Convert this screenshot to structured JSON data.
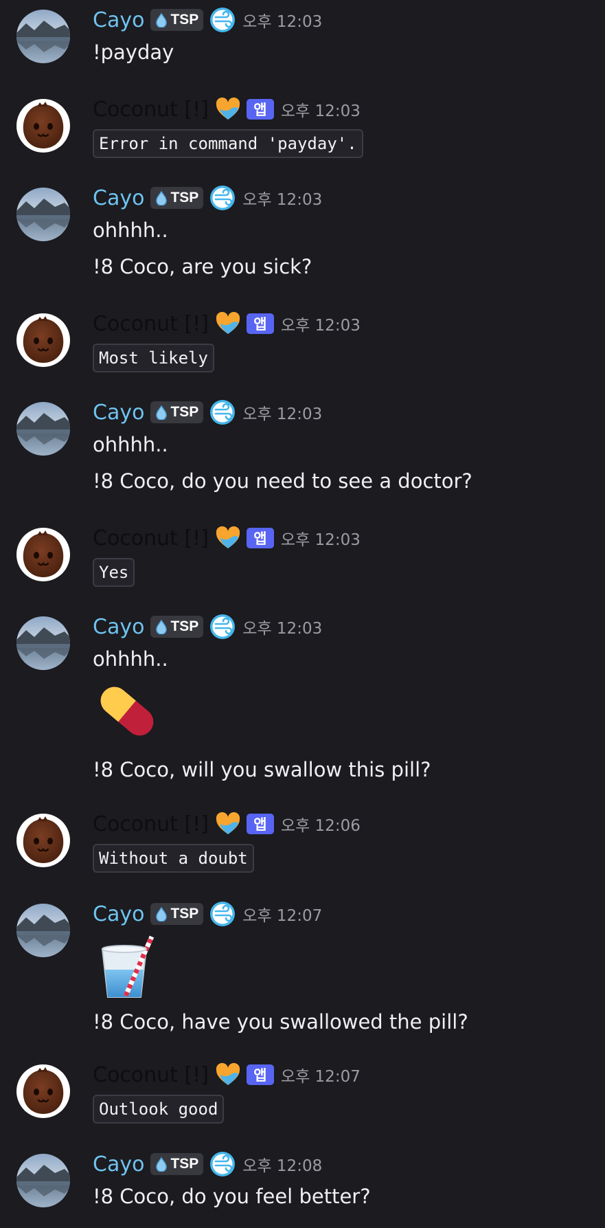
{
  "users": {
    "cayo": {
      "name": "Cayo",
      "tag": "TSP"
    },
    "coco": {
      "name": "Coconut [!]",
      "app_badge": "앱"
    }
  },
  "colors": {
    "background": "#1b1b20",
    "cayo_name": "#6fc3ef",
    "coconut_name": "#0e0e10",
    "app_badge": "#5865f2",
    "timestamp": "#9c9ca4"
  },
  "messages": [
    {
      "author": "Cayo",
      "time": "오후 12:03",
      "lines": [
        "!payday"
      ]
    },
    {
      "author": "Coconut [!]",
      "time": "오후 12:03",
      "code": "Error in command 'payday'."
    },
    {
      "author": "Cayo",
      "time": "오후 12:03",
      "lines": [
        "ohhhh..",
        "!8 Coco, are you sick?"
      ]
    },
    {
      "author": "Coconut [!]",
      "time": "오후 12:03",
      "code": "Most likely"
    },
    {
      "author": "Cayo",
      "time": "오후 12:03",
      "lines": [
        "ohhhh..",
        "!8 Coco, do you need to see a doctor?"
      ]
    },
    {
      "author": "Coconut [!]",
      "time": "오후 12:03",
      "code": "Yes"
    },
    {
      "author": "Cayo",
      "time": "오후 12:03",
      "lines": [
        "ohhhh.."
      ],
      "emoji": "pill-emoji",
      "after": "!8 Coco, will you swallow this pill?"
    },
    {
      "author": "Coconut [!]",
      "time": "오후 12:06",
      "code": "Without a doubt"
    },
    {
      "author": "Cayo",
      "time": "오후 12:07",
      "emoji": "cup-with-straw-emoji",
      "after": "!8 Coco, have you swallowed the pill?"
    },
    {
      "author": "Coconut [!]",
      "time": "오후 12:07",
      "code": "Outlook good"
    },
    {
      "author": "Cayo",
      "time": "오후 12:08",
      "lines": [
        "!8 Coco, do you feel better?"
      ]
    }
  ],
  "icons": {
    "cayo_avatar": "lake-mountain-avatar",
    "coco_avatar": "coconut-face-avatar",
    "tag_icon": "water-drop-icon",
    "cayo_badge": "wind-swirl-badge-icon",
    "coco_badge": "orange-blue-heart-icon"
  }
}
